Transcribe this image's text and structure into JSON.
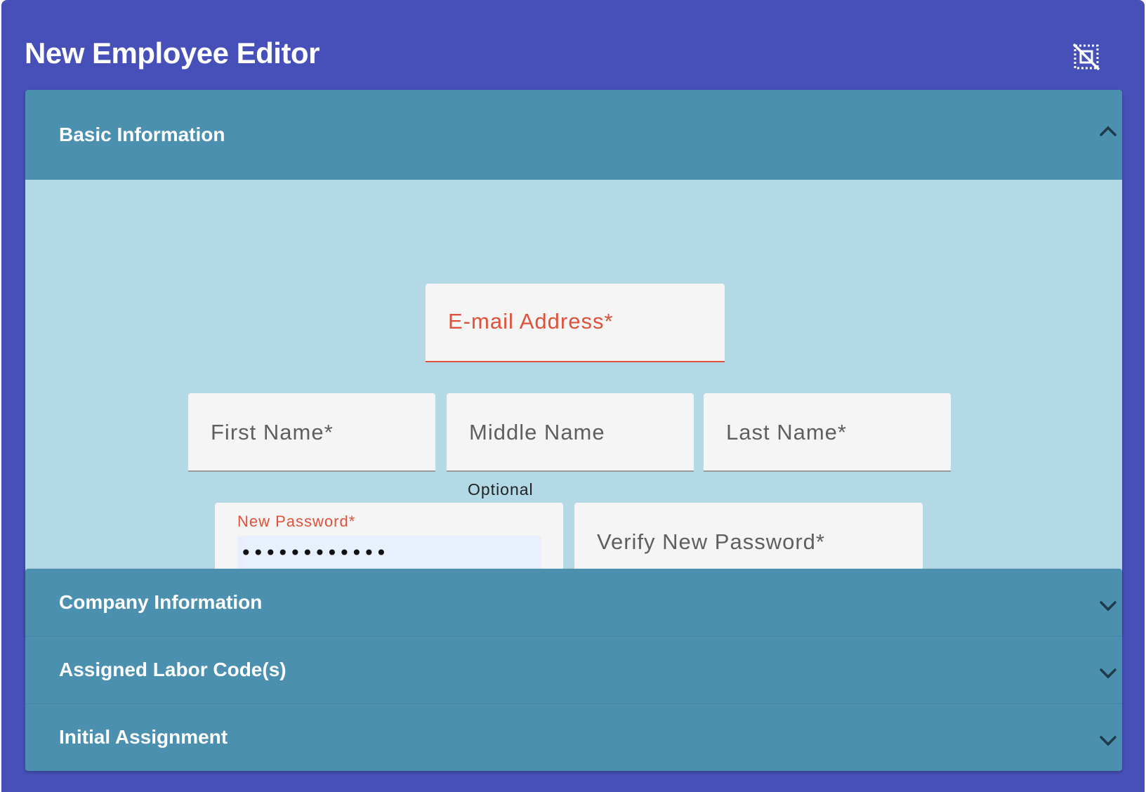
{
  "header": {
    "title": "New Employee Editor",
    "action_icon": "deselect-icon"
  },
  "colors": {
    "frame": "#4750b8",
    "panel_header": "#4c90b0",
    "panel_body": "#b3d8e6",
    "error": "#e0513a",
    "autofill": "#e8f0fe"
  },
  "sections": {
    "basic": {
      "label": "Basic Information",
      "expanded": true,
      "chevron_icon": "chevron-up-icon",
      "fields": {
        "email": {
          "label": "E-mail Address*",
          "value": ""
        },
        "first_name": {
          "label": "First Name*",
          "value": ""
        },
        "middle_name": {
          "label": "Middle Name",
          "value": "",
          "hint": "Optional"
        },
        "last_name": {
          "label": "Last Name*",
          "value": ""
        },
        "new_password": {
          "label": "New Password*",
          "value": "••••••••••••"
        },
        "verify_password": {
          "label": "Verify New Password*",
          "value": ""
        }
      }
    },
    "company": {
      "label": "Company Information",
      "expanded": false,
      "chevron_icon": "chevron-down-icon"
    },
    "labor": {
      "label": "Assigned Labor Code(s)",
      "expanded": false,
      "chevron_icon": "chevron-down-icon"
    },
    "assignment": {
      "label": "Initial Assignment",
      "expanded": false,
      "chevron_icon": "chevron-down-icon"
    }
  }
}
